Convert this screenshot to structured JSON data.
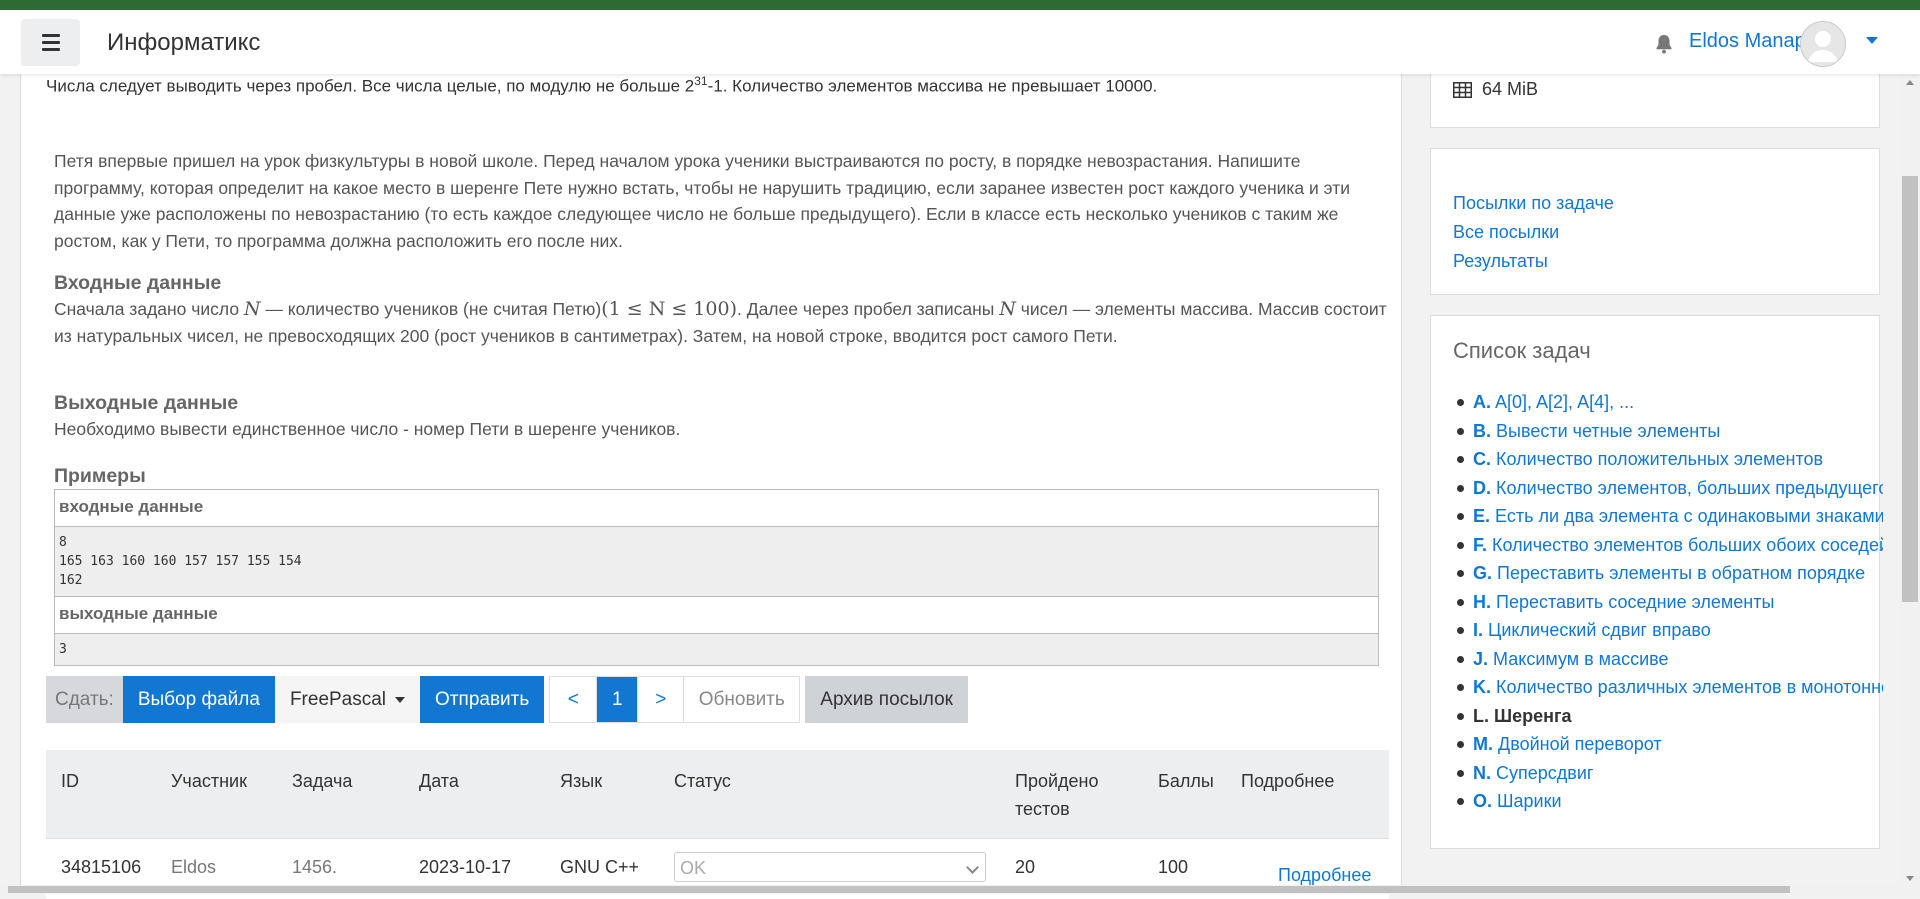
{
  "navbar": {
    "site_name": "Информатикс",
    "user_name": "Eldos Manap"
  },
  "problem": {
    "top_line_prefix": "Числа следует выводить через пробел. Все числа целые, по модулю не больше 2",
    "top_line_sup": "31",
    "top_line_suffix": "-1. Количество элементов массива не превышает 10000.",
    "statement": "Петя впервые пришел на урок физкультуры в новой школе. Перед началом урока ученики выстраиваются по росту, в порядке невозрастания. Напишите программу, которая определит на какое место в шеренге Пете нужно встать, чтобы не нарушить традицию, если заранее известен рост каждого ученика и эти данные уже расположены по невозрастанию (то есть каждое следующее число не больше предыдущего). Если в классе есть несколько учеников с таким же ростом, как у Пети, то программа должна расположить его после них.",
    "input_title": "Входные данные",
    "input_part1": "Сначала задано число ",
    "input_math_N": "N",
    "input_part2": " — количество учеников (не считая Петю)",
    "input_math_range": "(1 ≤ N ≤ 100)",
    "input_part3": ". Далее через пробел записаны ",
    "input_part4": " чисел — элементы массива. Массив состоит из натуральных чисел, не превосходящих 200 (рост учеников в сантиметрах). Затем, на новой строке, вводится рост самого Пети.",
    "output_title": "Выходные данные",
    "output_text": "Необходимо вывести единственное число - номер Пети в шеренге учеников.",
    "examples_title": "Примеры",
    "sample_input_label": "входные данные",
    "sample_input": "8\n165 163 160 160 157 157 155 154\n162",
    "sample_output_label": "выходные данные",
    "sample_output": "3"
  },
  "toolbar": {
    "submit_label": "Сдать:",
    "choose_file": "Выбор файла",
    "language": "FreePascal",
    "send": "Отправить",
    "prev": "<",
    "page": "1",
    "next": ">",
    "refresh": "Обновить",
    "archive": "Архив посылок"
  },
  "submissions": {
    "headers": [
      "ID",
      "Участник",
      "Задача",
      "Дата",
      "Язык",
      "Статус",
      "Пройдено тестов",
      "Баллы",
      "Подробнее"
    ],
    "rows": [
      {
        "id": "34815106",
        "user": "Eldos",
        "task": "1456.",
        "date": "2023-10-17",
        "lang": "GNU C++",
        "status": "OK",
        "tests": "20",
        "score": "100",
        "details": "Подробнее"
      }
    ]
  },
  "sidebar": {
    "memory_limit": "64 MiB",
    "links": [
      "Посылки по задаче",
      "Все посылки",
      "Результаты"
    ],
    "task_list_title": "Список задач",
    "tasks": [
      {
        "letter": "A.",
        "name": "A[0], A[2], A[4], ..."
      },
      {
        "letter": "B.",
        "name": "Вывести четные элементы"
      },
      {
        "letter": "C.",
        "name": "Количество положительных элементов"
      },
      {
        "letter": "D.",
        "name": "Количество элементов, больших предыдущего"
      },
      {
        "letter": "E.",
        "name": "Есть ли два элемента с одинаковыми знаками"
      },
      {
        "letter": "F.",
        "name": "Количество элементов больших обоих соседей"
      },
      {
        "letter": "G.",
        "name": "Переставить элементы в обратном порядке"
      },
      {
        "letter": "H.",
        "name": "Переставить соседние элементы"
      },
      {
        "letter": "I.",
        "name": "Циклический сдвиг вправо"
      },
      {
        "letter": "J.",
        "name": "Максимум в массиве"
      },
      {
        "letter": "K.",
        "name": "Количество различных элементов в монотонном массиве"
      },
      {
        "letter": "L.",
        "name": "Шеренга"
      },
      {
        "letter": "M.",
        "name": "Двойной переворот"
      },
      {
        "letter": "N.",
        "name": "Суперсдвиг"
      },
      {
        "letter": "O.",
        "name": "Шарики"
      }
    ]
  },
  "colors": {
    "accent": "#1177d1",
    "top_accent": "#2d6a34"
  }
}
